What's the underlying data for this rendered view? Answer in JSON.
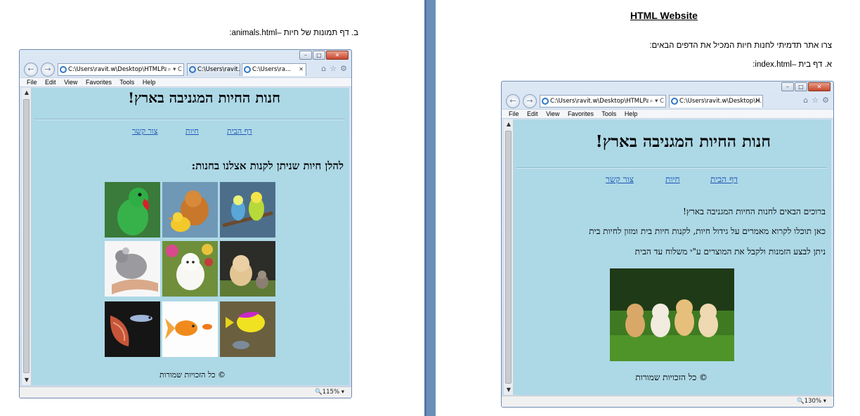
{
  "document": {
    "heading": "HTML Website",
    "intro": "צרו אתר תדמיתי לחנות חיות המכיל את הדפים הבאים:",
    "item_a": "א.   דף בית –index.html:",
    "item_b": "ב.   דף תמונות של חיות –animals.html:"
  },
  "browser_common": {
    "address_path": "C:\\Users\\ravit.w\\Desktop\\HTMLPa",
    "address_ctl": "⌕ ▾ C",
    "menu": [
      "File",
      "Edit",
      "View",
      "Favorites",
      "Tools",
      "Help"
    ],
    "tab_other": "C:\\Users\\ravit.w\\Desktop\\H...",
    "tab_short_a": "C:\\Users\\ravit.w\\...",
    "tab_short_b": "C:\\Users\\ra..."
  },
  "animals_browser": {
    "zoom": "115%",
    "title": "חנות החיות המגניבה בארץ!",
    "nav": [
      "דף הבית",
      "חיות",
      "צור קשר"
    ],
    "subtitle": "להלן חיות שניתן לקנות אצלנו בחנות:",
    "footer": "© כל הזכויות שמורות",
    "photos": [
      "parrot",
      "kitten-and-duckling",
      "budgies",
      "chinchilla",
      "white-puppy",
      "puppy-and-kitten",
      "guppy-fish",
      "goldfish",
      "tropical-fish"
    ]
  },
  "index_browser": {
    "zoom": "130%",
    "title": "חנות החיות המגניבה בארץ!",
    "nav": [
      "דף הבית",
      "חיות",
      "צור קשר"
    ],
    "lines": [
      "ברוכים הבאים לחנות החיות המגניבה בארץ!",
      "כאן תוכלו לקרוא מאמרים על גידול חיות, לקנות חיות בית ומזון לחיות בית",
      "ניתן לבצע הזמנות ולקבל את המוצרים ע\"י משלוח עד הבית"
    ],
    "photo": "puppies-on-grass",
    "footer": "© כל הזכויות שמורות"
  }
}
